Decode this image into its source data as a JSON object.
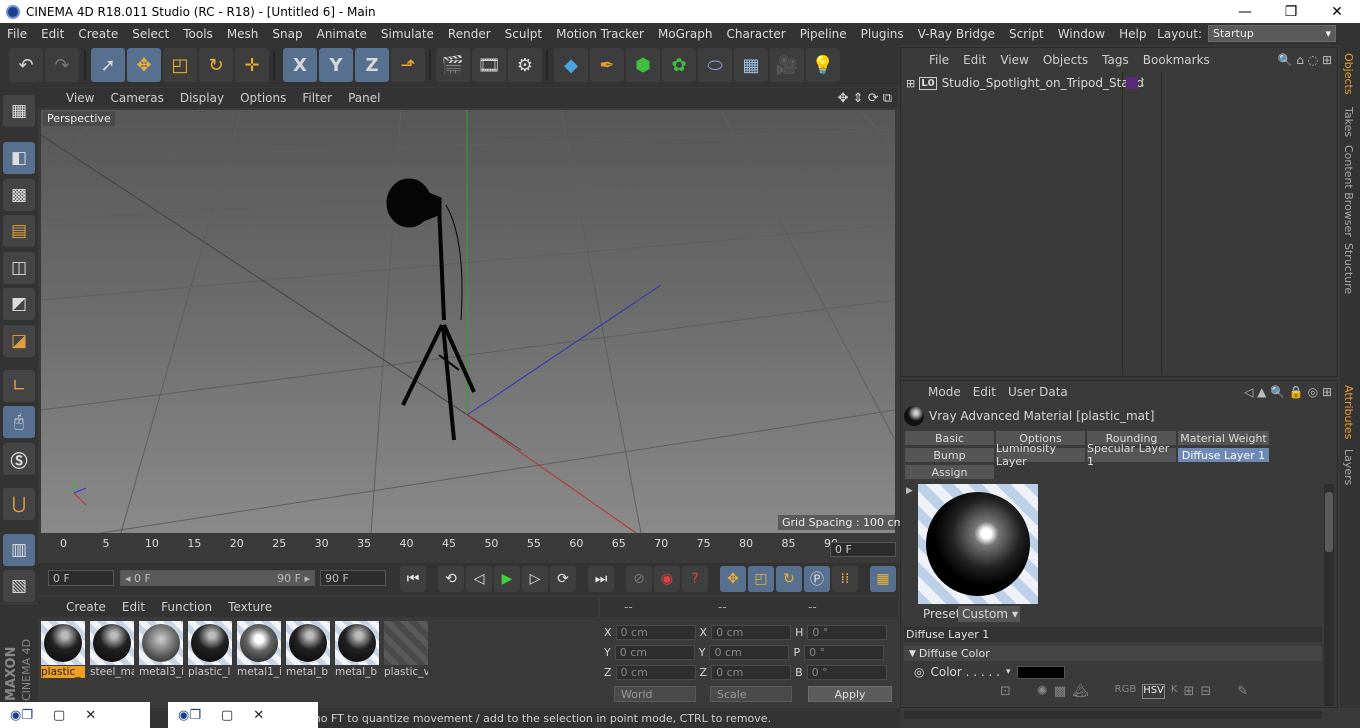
{
  "window": {
    "title": "CINEMA 4D R18.011 Studio (RC - R18) - [Untitled 6] - Main",
    "controls": [
      "—",
      "❐",
      "✕"
    ]
  },
  "menubar": [
    "File",
    "Edit",
    "Create",
    "Select",
    "Tools",
    "Mesh",
    "Snap",
    "Animate",
    "Simulate",
    "Render",
    "Sculpt",
    "Motion Tracker",
    "MoGraph",
    "Character",
    "Pipeline",
    "Plugins",
    "V-Ray Bridge",
    "Script",
    "Window",
    "Help"
  ],
  "layout": {
    "label": "Layout:",
    "value": "Startup"
  },
  "toolbar": {
    "icons": [
      "undo-icon",
      "redo-icon",
      "live-selection-icon",
      "move-icon",
      "scale-icon",
      "rotate-icon",
      "recent-tool-icon",
      "x-axis-icon",
      "y-axis-icon",
      "z-axis-icon",
      "coordinate-system-icon",
      "render-view-icon",
      "render-picture-viewer-icon",
      "edit-render-settings-icon",
      "cube-icon",
      "pen-icon",
      "subdivision-icon",
      "cloner-icon",
      "deformer-icon",
      "floor-icon",
      "camera-icon",
      "light-icon"
    ],
    "axis_labels": [
      "X",
      "Y",
      "Z"
    ]
  },
  "left_tools": [
    "make-editable-icon",
    "model-mode-icon",
    "texture-mode-icon",
    "workplane-mode-icon",
    "points-mode-icon",
    "edges-mode-icon",
    "polygons-mode-icon",
    "enable-axis-icon",
    "tweak-mode-icon",
    "solo-icon",
    "snap-icon",
    "workplane-lock-icon",
    "planar-workplane-icon"
  ],
  "viewport": {
    "menu": [
      "View",
      "Cameras",
      "Display",
      "Options",
      "Filter",
      "Panel"
    ],
    "label": "Perspective",
    "grid_spacing": "Grid Spacing : 100 cm"
  },
  "timeline": {
    "ticks": [
      "0",
      "5",
      "10",
      "15",
      "20",
      "25",
      "30",
      "35",
      "40",
      "45",
      "50",
      "55",
      "60",
      "65",
      "70",
      "75",
      "80",
      "85",
      "90"
    ],
    "current_frame": "0 F"
  },
  "transport": {
    "start": "0 F",
    "range_start": "◂ 0 F",
    "range_end": "90 F ▸",
    "end": "90 F"
  },
  "material_manager": {
    "menu": [
      "Create",
      "Edit",
      "Function",
      "Texture"
    ],
    "materials": [
      "plastic_",
      "steel_ma",
      "metal3_i",
      "plastic_l",
      "metal1_i",
      "metal_b",
      "metal_b",
      "plastic_v"
    ]
  },
  "coordinates": {
    "headers": [
      "--",
      "--",
      "--"
    ],
    "rows": [
      {
        "a": "X",
        "av": "0 cm",
        "b": "X",
        "bv": "0 cm",
        "c": "H",
        "cv": "0 °"
      },
      {
        "a": "Y",
        "av": "0 cm",
        "b": "Y",
        "bv": "0 cm",
        "c": "P",
        "cv": "0 °"
      },
      {
        "a": "Z",
        "av": "0 cm",
        "b": "Z",
        "bv": "0 cm",
        "c": "B",
        "cv": "0 °"
      }
    ],
    "space": "World",
    "mode": "Scale",
    "apply": "Apply"
  },
  "status": "mo                                                                           FT to quantize movement / add to the selection in point mode, CTRL to remove.",
  "objects": {
    "menu": [
      "File",
      "Edit",
      "View",
      "Objects",
      "Tags",
      "Bookmarks"
    ],
    "items": [
      {
        "name": "Studio_Spotlight_on_Tripod_Stand"
      }
    ]
  },
  "side_tabs_top": [
    "Objects",
    "Takes",
    "Content Browser",
    "Structure"
  ],
  "side_tabs_bottom": [
    "Attributes",
    "Layers"
  ],
  "attributes": {
    "menu": [
      "Mode",
      "Edit",
      "User Data"
    ],
    "title": "Vray Advanced Material [plastic_mat]",
    "tabs": [
      "Basic",
      "Options",
      "Rounding",
      "Material Weight",
      "Bump",
      "Luminosity Layer",
      "Specular Layer 1",
      "Diffuse Layer 1",
      "Assign"
    ],
    "preset_label": "Preset",
    "preset_value": "Custom",
    "section": "Diffuse Layer 1",
    "subsection": "Diffuse Color",
    "color_label": "Color . . . . .",
    "color_value": "#000000"
  },
  "colors": {
    "accent": "#58708f",
    "selected_material": "#f0a020",
    "active_tab": "#6d89b4",
    "x_axis": "#c03030",
    "y_axis": "#30c030",
    "z_axis": "#3030c0"
  }
}
